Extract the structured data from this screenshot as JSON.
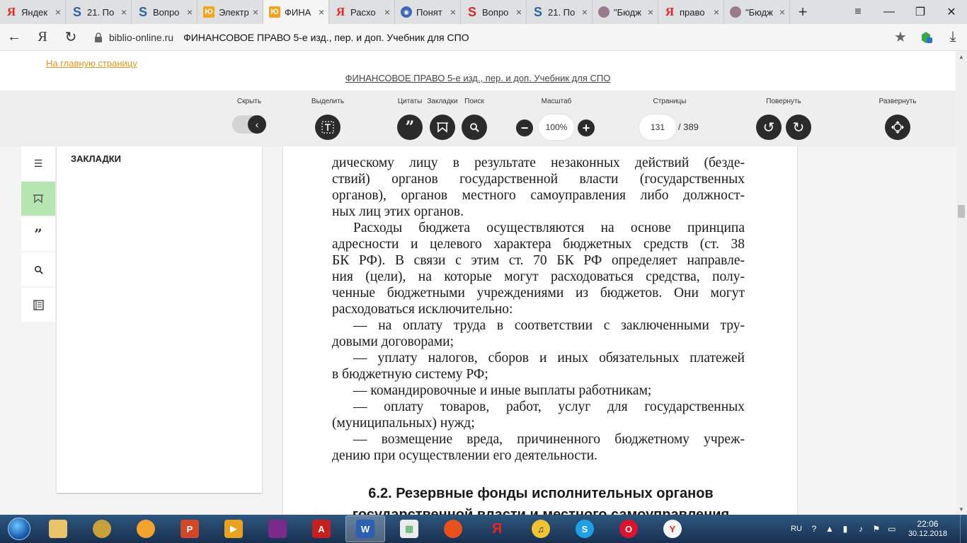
{
  "tabs": [
    {
      "title": "Яндек",
      "icon": "yandex-icon"
    },
    {
      "title": "21. По",
      "icon": "s-site-icon"
    },
    {
      "title": "Вопро",
      "icon": "s-site-icon"
    },
    {
      "title": "Электр",
      "icon": "urait-icon"
    },
    {
      "title": "ФИНА",
      "icon": "urait-icon",
      "active": true
    },
    {
      "title": "Расхо",
      "icon": "yandex-icon"
    },
    {
      "title": "Понят",
      "icon": "globe-icon"
    },
    {
      "title": "Вопро",
      "icon": "s-red-icon"
    },
    {
      "title": "21. По",
      "icon": "s-site-icon"
    },
    {
      "title": "\"Бюдж",
      "icon": "image-icon"
    },
    {
      "title": "право",
      "icon": "yandex-icon"
    },
    {
      "title": "\"Бюдж",
      "icon": "image-icon"
    }
  ],
  "address": {
    "domain": "biblio-online.ru",
    "title": "ФИНАНСОВОЕ ПРАВО 5-е изд., пер. и доп. Учебник для СПО"
  },
  "site": {
    "home_link": "На главную страницу",
    "book_link": "ФИНАНСОВОЕ ПРАВО 5-е изд., пер. и доп. Учебник для СПО"
  },
  "toolbar": {
    "hide_label": "Скрыть",
    "select_label": "Выделить",
    "quotes_label": "Цитаты",
    "bookmarks_label": "Закладки",
    "search_label": "Поиск",
    "zoom_label": "Масштаб",
    "zoom_value": "100%",
    "pages_label": "Страницы",
    "page_current": "131",
    "page_total": "/ 389",
    "rotate_label": "Повернуть",
    "expand_label": "Развернуть"
  },
  "panel": {
    "title": "ЗАКЛАДКИ"
  },
  "page": {
    "lines": [
      {
        "text": "дическому лицу в результате незаконных действий (безде-",
        "style": "j"
      },
      {
        "text": "ствий) органов государственной власти (государственных",
        "style": "j"
      },
      {
        "text": "органов), органов местного самоуправления либо должност-",
        "style": "j"
      },
      {
        "text": "ных лиц этих органов.",
        "style": ""
      },
      {
        "text": "Расходы бюджета осуществляются на основе принципа",
        "style": "j ind"
      },
      {
        "text": "адресности и целевого характера бюджетных средств (ст. 38",
        "style": "j"
      },
      {
        "text": "БК РФ). В связи с этим ст. 70 БК РФ определяет направле-",
        "style": "j"
      },
      {
        "text": "ния (цели), на которые могут расходоваться средства, полу-",
        "style": "j"
      },
      {
        "text": "ченные бюджетными учреждениями из бюджетов. Они могут",
        "style": "j"
      },
      {
        "text": "расходоваться исключительно:",
        "style": ""
      },
      {
        "text": "— на оплату труда в соответствии с заключенными тру-",
        "style": "j ind"
      },
      {
        "text": "довыми договорами;",
        "style": ""
      },
      {
        "text": "— уплату налогов, сборов и иных обязательных платежей",
        "style": "j ind"
      },
      {
        "text": "в бюджетную систему РФ;",
        "style": ""
      },
      {
        "text": "— командировочные и иные выплаты работникам;",
        "style": "ind"
      },
      {
        "text": "— оплату товаров, работ, услуг для государственных",
        "style": "j ind"
      },
      {
        "text": "(муниципальных) нужд;",
        "style": ""
      },
      {
        "text": "— возмещение вреда, причиненного бюджетному учреж-",
        "style": "j ind"
      },
      {
        "text": "дению при осуществлении его деятельности.",
        "style": ""
      }
    ],
    "heading_line1": "6.2. Резервные фонды исполнительных органов",
    "heading_line2": "государственной власти и местного самоуправления"
  },
  "taskbar": {
    "lang": "RU",
    "time": "22:06",
    "date": "30.12.2018"
  },
  "colors": {
    "accent_link": "#e6961e",
    "active_rail": "#b5e6b1",
    "button_dark": "#2b2b2b"
  }
}
